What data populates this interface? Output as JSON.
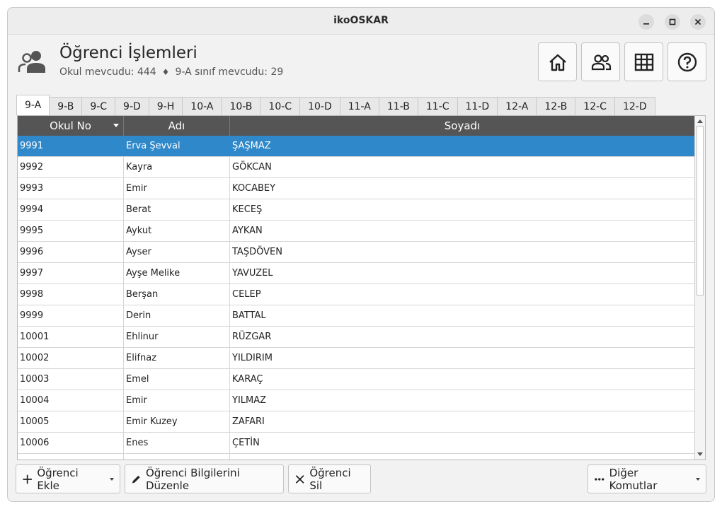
{
  "window": {
    "title": "ikoOSKAR"
  },
  "header": {
    "title": "Öğrenci İşlemleri",
    "school_count": "Okul mevcudu: 444",
    "separator": "♦",
    "class_count": "9-A sınıf mevcudu: 29"
  },
  "toolbar": {
    "icons": [
      "home-icon",
      "users-icon",
      "table-icon",
      "help-icon"
    ]
  },
  "tabs": [
    "9-A",
    "9-B",
    "9-C",
    "9-D",
    "9-H",
    "10-A",
    "10-B",
    "10-C",
    "10-D",
    "11-A",
    "11-B",
    "11-C",
    "11-D",
    "12-A",
    "12-B",
    "12-C",
    "12-D"
  ],
  "active_tab": "9-A",
  "table": {
    "columns": [
      "Okul No",
      "Adı",
      "Soyadı"
    ],
    "rows": [
      [
        "9991",
        "Erva Şevval",
        "ŞAŞMAZ"
      ],
      [
        "9992",
        "Kayra",
        "GÖKCAN"
      ],
      [
        "9993",
        "Emir",
        "KOCABEY"
      ],
      [
        "9994",
        "Berat",
        "KECEŞ"
      ],
      [
        "9995",
        "Aykut",
        "AYKAN"
      ],
      [
        "9996",
        "Ayser",
        "TAŞDÖVEN"
      ],
      [
        "9997",
        "Ayşe Melike",
        "YAVUZEL"
      ],
      [
        "9998",
        "Berşan",
        "CELEP"
      ],
      [
        "9999",
        "Derin",
        "BATTAL"
      ],
      [
        "10001",
        "Ehlinur",
        "RÜZGAR"
      ],
      [
        "10002",
        "Elifnaz",
        "YILDIRIM"
      ],
      [
        "10003",
        "Emel",
        "KARAÇ"
      ],
      [
        "10004",
        "Emir",
        "YILMAZ"
      ],
      [
        "10005",
        "Emir Kuzey",
        "ZAFARI"
      ],
      [
        "10006",
        "Enes",
        "ÇETİN"
      ]
    ]
  },
  "buttons": {
    "add": "Öğrenci Ekle",
    "edit": "Öğrenci Bilgilerini Düzenle",
    "delete": "Öğrenci Sil",
    "more": "Diğer Komutlar"
  },
  "colors": {
    "selection": "#2f88c9",
    "header_bg": "#555555"
  }
}
